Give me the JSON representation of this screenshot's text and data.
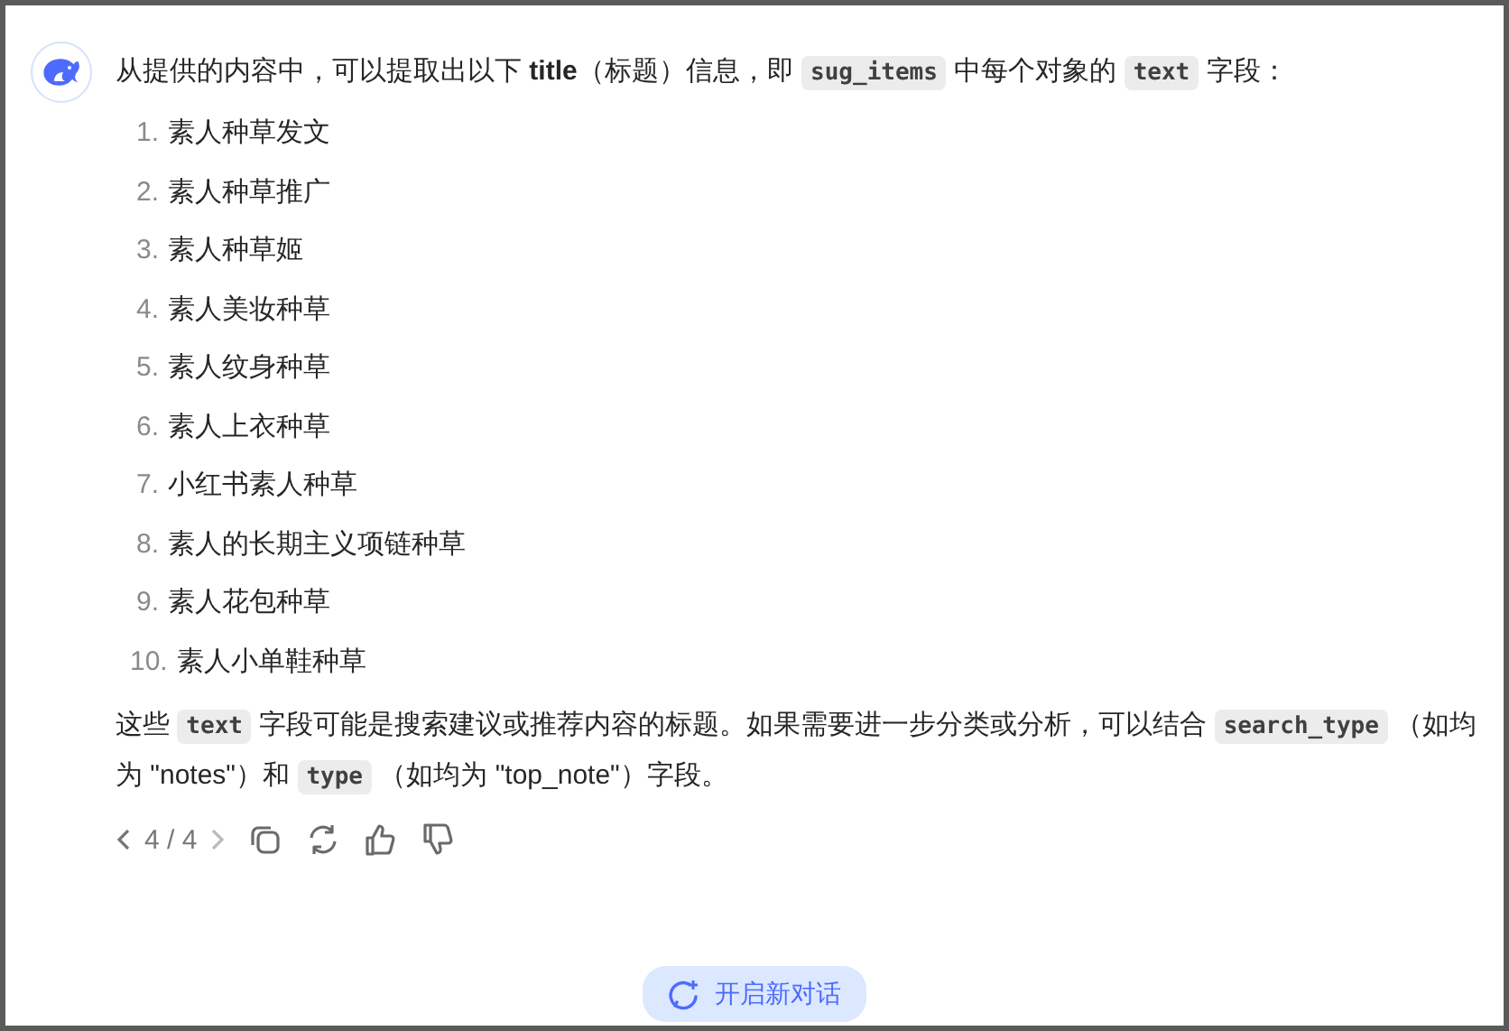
{
  "message": {
    "intro": [
      {
        "kind": "text",
        "text": "从提供的内容中，可以提取出以下 "
      },
      {
        "kind": "bold",
        "text": "title"
      },
      {
        "kind": "text",
        "text": "（标题）信息，即 "
      },
      {
        "kind": "code",
        "text": "sug_items"
      },
      {
        "kind": "text",
        "text": " 中每个对象的 "
      },
      {
        "kind": "code",
        "text": "text"
      },
      {
        "kind": "text",
        "text": " 字段："
      }
    ],
    "items": [
      {
        "number": "1.",
        "text": "素人种草发文"
      },
      {
        "number": "2.",
        "text": "素人种草推广"
      },
      {
        "number": "3.",
        "text": "素人种草姬"
      },
      {
        "number": "4.",
        "text": "素人美妆种草"
      },
      {
        "number": "5.",
        "text": "素人纹身种草"
      },
      {
        "number": "6.",
        "text": "素人上衣种草"
      },
      {
        "number": "7.",
        "text": "小红书素人种草"
      },
      {
        "number": "8.",
        "text": "素人的长期主义项链种草"
      },
      {
        "number": "9.",
        "text": "素人花包种草"
      },
      {
        "number": "10.",
        "text": "素人小单鞋种草"
      }
    ],
    "outro": [
      {
        "kind": "text",
        "text": "这些 "
      },
      {
        "kind": "code",
        "text": "text"
      },
      {
        "kind": "text",
        "text": " 字段可能是搜索建议或推荐内容的标题。如果需要进一步分类或分析，可以结合 "
      },
      {
        "kind": "code",
        "text": "search_type"
      },
      {
        "kind": "text",
        "text": " （如均为 \"notes\"）和 "
      },
      {
        "kind": "code",
        "text": "type"
      },
      {
        "kind": "text",
        "text": " （如均为 \"top_note\"）字段。"
      }
    ]
  },
  "pager": {
    "label": "4 / 4"
  },
  "new_chat_button": {
    "label": "开启新对话"
  }
}
